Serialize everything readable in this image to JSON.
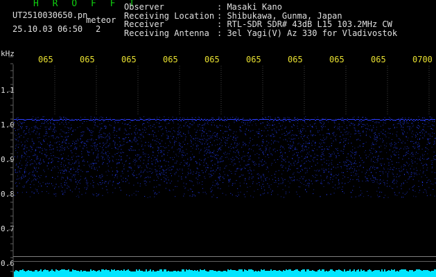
{
  "header": {
    "brand": "H R O F F T",
    "filename": "UT2510030650.pn",
    "meteor_tag": "meteor",
    "datetime": "25.10.03 06:50",
    "count": "2",
    "info": [
      {
        "key": "Observer",
        "value": ": Masaki Kano"
      },
      {
        "key": "Receiving Location",
        "value": ": Shibukawa, Gunma, Japan"
      },
      {
        "key": "Receiver",
        "value": ": RTL-SDR SDR# 43dB L15 103.2MHz CW"
      },
      {
        "key": "Receiving Antenna",
        "value": ": 3el Yagi(V) Az 330 for Vladivostok"
      }
    ]
  },
  "axis": {
    "yunit": "kHz",
    "time_labels": [
      "065",
      "065",
      "065",
      "065",
      "065",
      "065",
      "065",
      "065",
      "065",
      "0700"
    ],
    "freq_labels": [
      "1.1",
      "1.0",
      "0.9",
      "0.8",
      "0.7",
      "0.6"
    ]
  },
  "colors": {
    "background": "#000000",
    "text": "#e0e0e0",
    "brand": "#10d010",
    "time_ticks": "#e8e030",
    "signal": "#2a3cff",
    "noise_floor": "#00e5ff",
    "grid": "#606060"
  }
}
